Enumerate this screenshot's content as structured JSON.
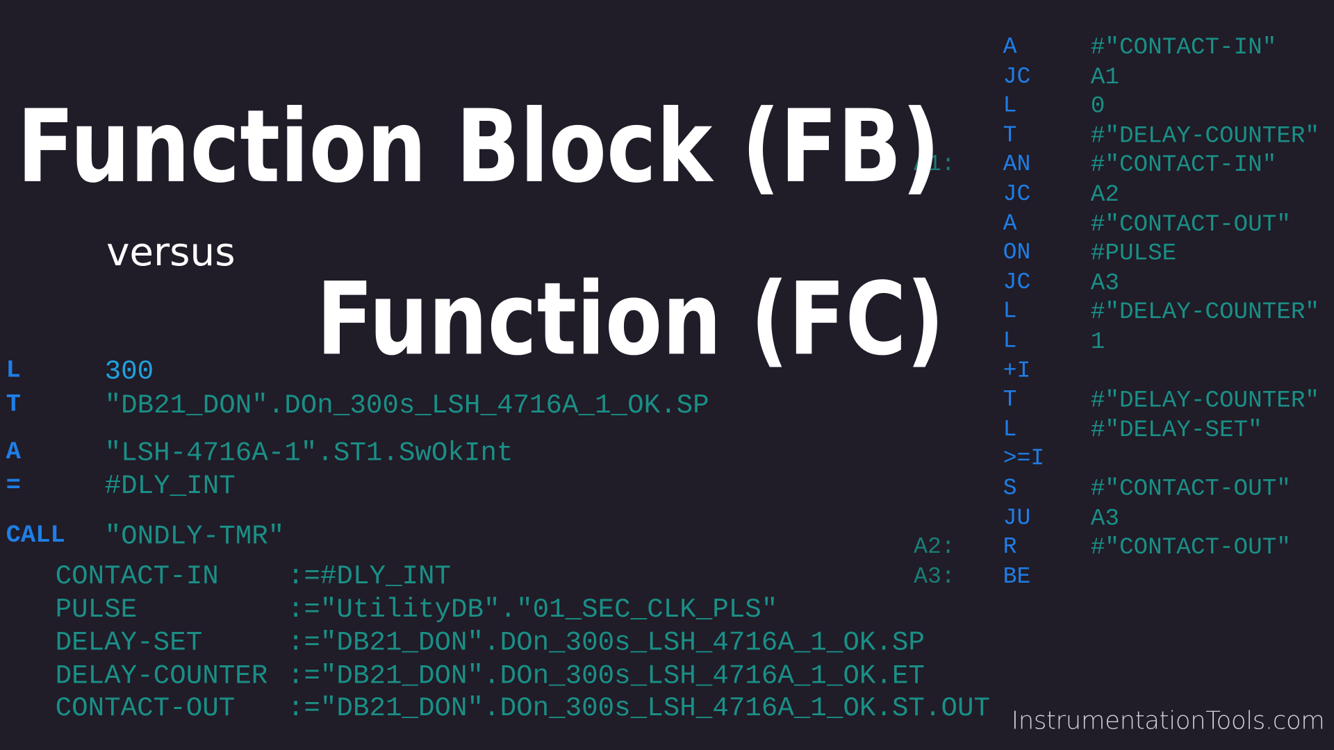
{
  "colors": {
    "background": "#201c28",
    "title": "#ffffff",
    "operation": "#1f7ee6",
    "operand": "#1a8f86",
    "footer": "#cfcfd4"
  },
  "title": {
    "line1": "Function Block (FB)",
    "versus": "versus",
    "line2": "Function (FC)"
  },
  "left_code": {
    "lines": [
      {
        "op": "L",
        "arg": "300"
      },
      {
        "op": "T",
        "arg": "\"DB21_DON\".DOn_300s_LSH_4716A_1_OK.SP"
      },
      {
        "op": "A",
        "arg": "\"LSH-4716A-1\".ST1.SwOkInt"
      },
      {
        "op": "=",
        "arg": "#DLY_INT"
      },
      {
        "op": "CALL",
        "arg": "\"ONDLY-TMR\""
      }
    ],
    "params": [
      {
        "name": "CONTACT-IN",
        "value": ":=#DLY_INT"
      },
      {
        "name": "PULSE",
        "value": ":=\"UtilityDB\".\"01_SEC_CLK_PLS\""
      },
      {
        "name": "DELAY-SET",
        "value": ":=\"DB21_DON\".DOn_300s_LSH_4716A_1_OK.SP"
      },
      {
        "name": "DELAY-COUNTER",
        "value": ":=\"DB21_DON\".DOn_300s_LSH_4716A_1_OK.ET"
      },
      {
        "name": "CONTACT-OUT",
        "value": ":=\"DB21_DON\".DOn_300s_LSH_4716A_1_OK.ST.OUT"
      }
    ]
  },
  "right_code": {
    "lines": [
      {
        "label": "",
        "op": "A",
        "arg": "#\"CONTACT-IN\""
      },
      {
        "label": "",
        "op": "JC",
        "arg": "A1"
      },
      {
        "label": "",
        "op": "L",
        "arg": "0"
      },
      {
        "label": "",
        "op": "T",
        "arg": "#\"DELAY-COUNTER\""
      },
      {
        "label": "A1:",
        "op": "AN",
        "arg": "#\"CONTACT-IN\""
      },
      {
        "label": "",
        "op": "JC",
        "arg": "A2"
      },
      {
        "label": "",
        "op": "A",
        "arg": "#\"CONTACT-OUT\""
      },
      {
        "label": "",
        "op": "ON",
        "arg": "#PULSE"
      },
      {
        "label": "",
        "op": "JC",
        "arg": "A3"
      },
      {
        "label": "",
        "op": "L",
        "arg": "#\"DELAY-COUNTER\""
      },
      {
        "label": "",
        "op": "L",
        "arg": "1"
      },
      {
        "label": "",
        "op": "+I",
        "arg": ""
      },
      {
        "label": "",
        "op": "T",
        "arg": "#\"DELAY-COUNTER\""
      },
      {
        "label": "",
        "op": "L",
        "arg": "#\"DELAY-SET\""
      },
      {
        "label": "",
        "op": ">=I",
        "arg": ""
      },
      {
        "label": "",
        "op": "S",
        "arg": "#\"CONTACT-OUT\""
      },
      {
        "label": "",
        "op": "JU",
        "arg": "A3"
      },
      {
        "label": "A2:",
        "op": "R",
        "arg": "#\"CONTACT-OUT\""
      },
      {
        "label": "A3:",
        "op": "BE",
        "arg": ""
      }
    ]
  },
  "footer": {
    "watermark": "InstrumentationTools.com"
  }
}
